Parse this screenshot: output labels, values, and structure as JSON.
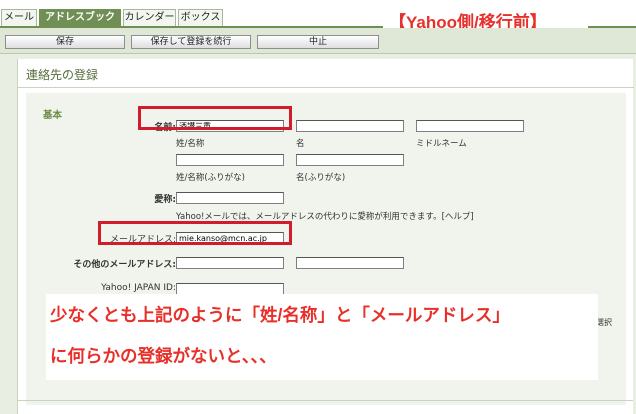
{
  "tabs": [
    "メール",
    "アドレスブック",
    "カレンダー",
    "ボックス"
  ],
  "active_tab": "アドレスブック",
  "headline": "【Yahoo側/移行前】",
  "toolbar": {
    "save": "保存",
    "save_continue": "保存して登録を続行",
    "cancel": "中止"
  },
  "page_title": "連絡先の登録",
  "section_basic": "基本",
  "form": {
    "name_label": "名前:",
    "name_value": "酒讃三重",
    "name_sub_last": "姓/名称",
    "name_sub_first": "名",
    "name_sub_middle": "ミドルネーム",
    "kana_sub_last": "姓/名称(ふりがな)",
    "kana_sub_first": "名(ふりがな)",
    "nickname_label": "愛称:",
    "nickname_help": "Yahoo!メールでは、メールアドレスの代わりに愛称が利用できます。[ヘルプ]",
    "email_label": "メールアドレス:",
    "email_value": "mie.kanso@mcn.ac.jp",
    "other_email_label": "その他のメールアドレス:",
    "yahoo_id_label": "Yahoo! JAPAN ID:",
    "cut_off_text": "選択"
  },
  "annotation": {
    "line1": "少なくとも上記のように「姓/名称」と「メールアドレス」",
    "line2": "に何らかの登録がないと、、、"
  },
  "colors": {
    "accent_green": "#6f8f55",
    "highlight_red": "#d11d2b",
    "annotation_red": "#e8302a"
  }
}
